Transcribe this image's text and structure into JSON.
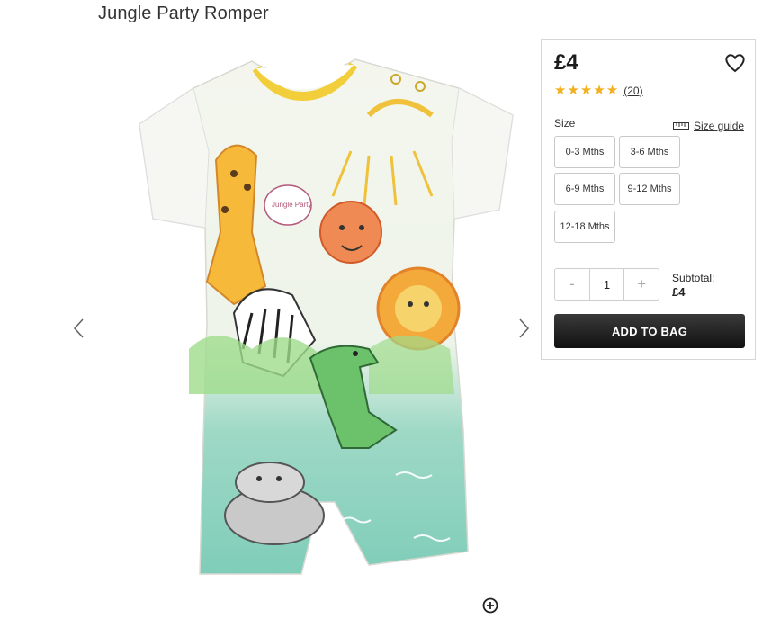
{
  "product": {
    "title": "Jungle Party Romper"
  },
  "gallery": {
    "prev_icon": "chevron-left-icon",
    "next_icon": "chevron-right-icon",
    "zoom_icon": "zoom-in-icon",
    "speech_bubble_text": "Jungle Party"
  },
  "buy_panel": {
    "price": "£4",
    "wishlist_icon": "heart-outline-icon",
    "rating": {
      "stars": 5,
      "max": 5,
      "review_count_label": "(20)"
    },
    "size_label": "Size",
    "size_guide_label": "Size guide",
    "size_guide_icon": "ruler-icon",
    "sizes": [
      "0-3 Mths",
      "3-6 Mths",
      "6-9 Mths",
      "9-12 Mths",
      "12-18 Mths"
    ],
    "quantity": {
      "minus_label": "-",
      "value": "1",
      "plus_label": "+"
    },
    "subtotal_label": "Subtotal:",
    "subtotal_value": "£4",
    "add_to_bag_label": "ADD TO BAG"
  },
  "colors": {
    "star": "#f2b01e",
    "button_dark": "#1c1c1c"
  }
}
